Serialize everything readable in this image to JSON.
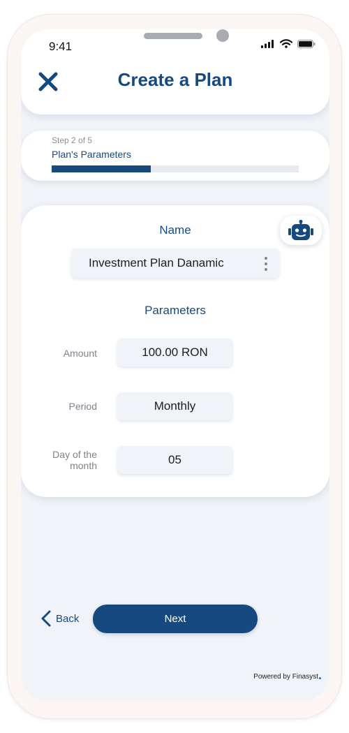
{
  "status_bar": {
    "time": "9:41"
  },
  "header": {
    "title": "Create a Plan"
  },
  "step": {
    "label": "Step 2 of 5",
    "name": "Plan's Parameters",
    "progress": 0.4
  },
  "form": {
    "name_title": "Name",
    "name_value": "Investment Plan Danamic",
    "parameters_title": "Parameters",
    "fields": [
      {
        "label": "Amount",
        "value": "100.00 RON"
      },
      {
        "label": "Period",
        "value": "Monthly"
      },
      {
        "label": "Day of the month",
        "value": "05"
      }
    ]
  },
  "footer": {
    "back_label": "Back",
    "next_label": "Next",
    "powered_by": "Powered by Finasyst"
  },
  "icons": [
    "close-icon",
    "robot-icon",
    "kebab-menu-icon",
    "chevron-left-icon",
    "signal-icon",
    "wifi-icon",
    "battery-icon"
  ],
  "colors": {
    "primary": "#164a7e",
    "background": "#f0f3f8",
    "card": "#ffffff",
    "frame": "#fbf5f3"
  }
}
